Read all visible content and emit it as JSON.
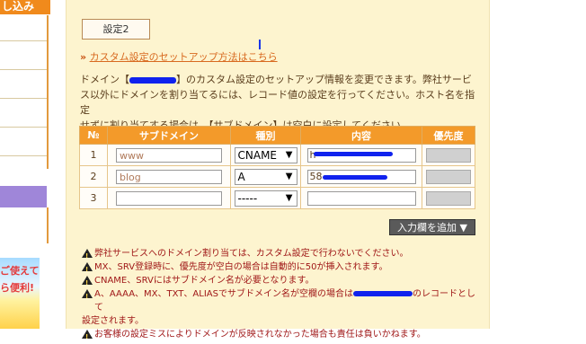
{
  "sidebar": {
    "header_text": "し込み",
    "banner_line1": "ご使えて",
    "banner_line2": "ら便利!"
  },
  "tab": {
    "label": "設定2"
  },
  "setup_link": {
    "arrow": "»",
    "label": "カスタム設定のセットアップ方法はこちら"
  },
  "description": {
    "line1_pre": "ドメイン【",
    "line1_post": "】のカスタム設定のセットアップ情報を変更できます。弊社サービ",
    "line2": "ス以外にドメインを割り当てるには、レコード値の設定を行ってください。ホスト名を指定",
    "line3": "せずに割り当てする場合は、【サブドメイン】は空白に設定してください。"
  },
  "table": {
    "headers": [
      "№",
      "サブドメイン",
      "種別",
      "内容",
      "優先度"
    ],
    "rows": [
      {
        "no": "1",
        "subdomain": "www",
        "type": "CNAME",
        "content": "h",
        "priority": ""
      },
      {
        "no": "2",
        "subdomain": "blog",
        "type": "A",
        "content": "58",
        "priority": ""
      },
      {
        "no": "3",
        "subdomain": "",
        "type": "-----",
        "content": "",
        "priority": ""
      }
    ]
  },
  "add_button": {
    "label": "入力欄を追加 ▼"
  },
  "notes": [
    "弊社サービスへのドメイン割り当ては、カスタム設定で行わないでください。",
    "MX、SRV登録時に、優先度が空白の場合は自動的に50が挿入されます。",
    "CNAME、SRVにはサブドメイン名が必要となります。",
    "A、AAAA、MX、TXT、ALIASでサブドメイン名が空欄の場合は",
    "のレコードとして",
    "設定されます。",
    "お客様の設定ミスによりドメインが反映されなかった場合も責任は負いかねます。"
  ],
  "colors": {
    "accent": "#f39a2a",
    "panel_bg": "#fdf4cf",
    "link": "#d86a20",
    "note_text": "#a01818"
  }
}
